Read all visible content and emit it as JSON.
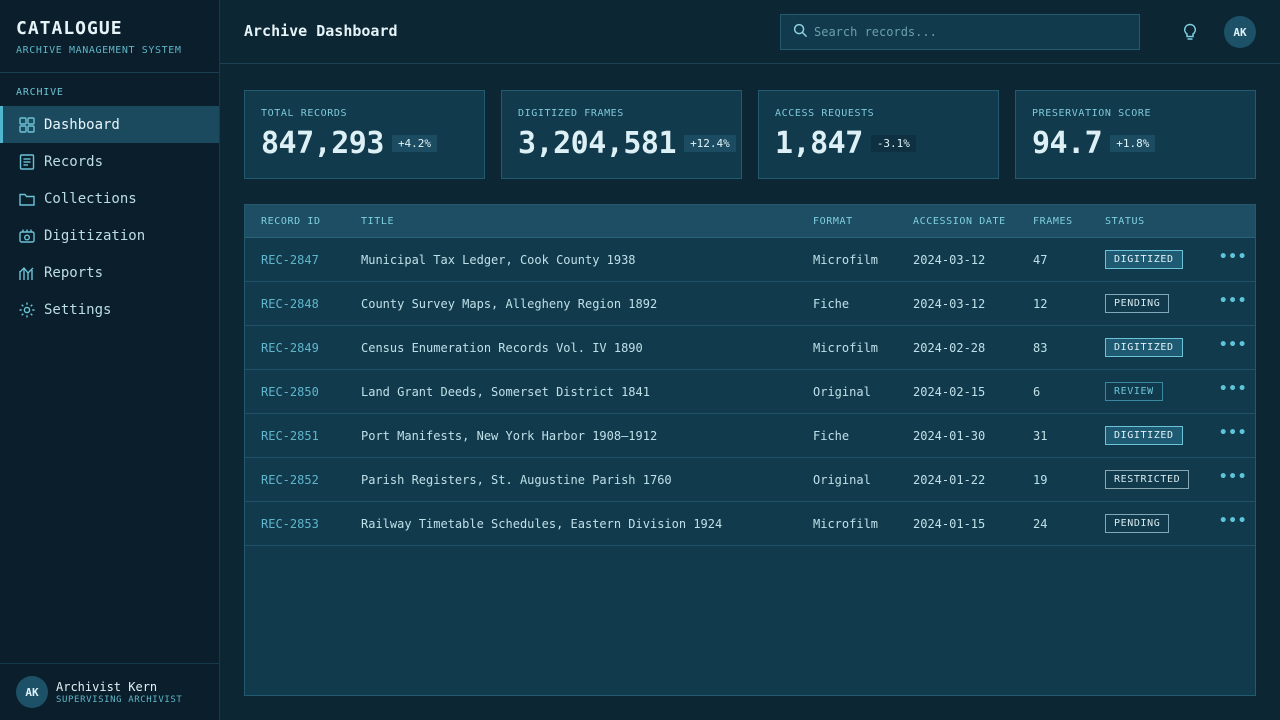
{
  "brand": {
    "title": "CATALOGUE",
    "subtitle": "ARCHIVE MANAGEMENT SYSTEM"
  },
  "sidebar": {
    "section": "ARCHIVE",
    "items": [
      {
        "label": "Dashboard",
        "icon": "grid-icon",
        "active": true
      },
      {
        "label": "Records",
        "icon": "document-icon"
      },
      {
        "label": "Collections",
        "icon": "folder-icon"
      },
      {
        "label": "Digitization",
        "icon": "scanner-icon"
      },
      {
        "label": "Reports",
        "icon": "chart-icon"
      },
      {
        "label": "Settings",
        "icon": "gear-icon"
      }
    ]
  },
  "user": {
    "initials": "AK",
    "name": "Archivist Kern",
    "role": "SUPERVISING ARCHIVIST"
  },
  "header": {
    "title": "Archive Dashboard",
    "search_placeholder": "Search records..."
  },
  "stats": [
    {
      "label": "TOTAL RECORDS",
      "value": "847,293",
      "delta": "+4.2%"
    },
    {
      "label": "DIGITIZED FRAMES",
      "value": "3,204,581",
      "delta": "+12.4%"
    },
    {
      "label": "ACCESS REQUESTS",
      "value": "1,847",
      "delta": "-3.1%"
    },
    {
      "label": "PRESERVATION SCORE",
      "value": "94.7",
      "delta": "+1.8%"
    }
  ],
  "table": {
    "columns": [
      "RECORD ID",
      "TITLE",
      "FORMAT",
      "ACCESSION DATE",
      "FRAMES",
      "STATUS"
    ],
    "rows": [
      {
        "id": "REC-2847",
        "title": "Municipal Tax Ledger, Cook County 1938",
        "format": "Microfilm",
        "date": "2024-03-12",
        "frames": "47",
        "status": "DIGITIZED"
      },
      {
        "id": "REC-2848",
        "title": "County Survey Maps, Allegheny Region 1892",
        "format": "Fiche",
        "date": "2024-03-12",
        "frames": "12",
        "status": "PENDING"
      },
      {
        "id": "REC-2849",
        "title": "Census Enumeration Records Vol. IV 1890",
        "format": "Microfilm",
        "date": "2024-02-28",
        "frames": "83",
        "status": "DIGITIZED"
      },
      {
        "id": "REC-2850",
        "title": "Land Grant Deeds, Somerset District 1841",
        "format": "Original",
        "date": "2024-02-15",
        "frames": "6",
        "status": "REVIEW"
      },
      {
        "id": "REC-2851",
        "title": "Port Manifests, New York Harbor 1908–1912",
        "format": "Fiche",
        "date": "2024-01-30",
        "frames": "31",
        "status": "DIGITIZED"
      },
      {
        "id": "REC-2852",
        "title": "Parish Registers, St. Augustine Parish 1760",
        "format": "Original",
        "date": "2024-01-22",
        "frames": "19",
        "status": "RESTRICTED"
      },
      {
        "id": "REC-2853",
        "title": "Railway Timetable Schedules, Eastern Division 1924",
        "format": "Microfilm",
        "date": "2024-01-15",
        "frames": "24",
        "status": "PENDING"
      }
    ],
    "more_label": "•••"
  },
  "colors": {
    "accent": "#4fb8cf",
    "background": "#0c2634",
    "sidebar": "#0a1f2b",
    "panel": "#113a4c"
  }
}
